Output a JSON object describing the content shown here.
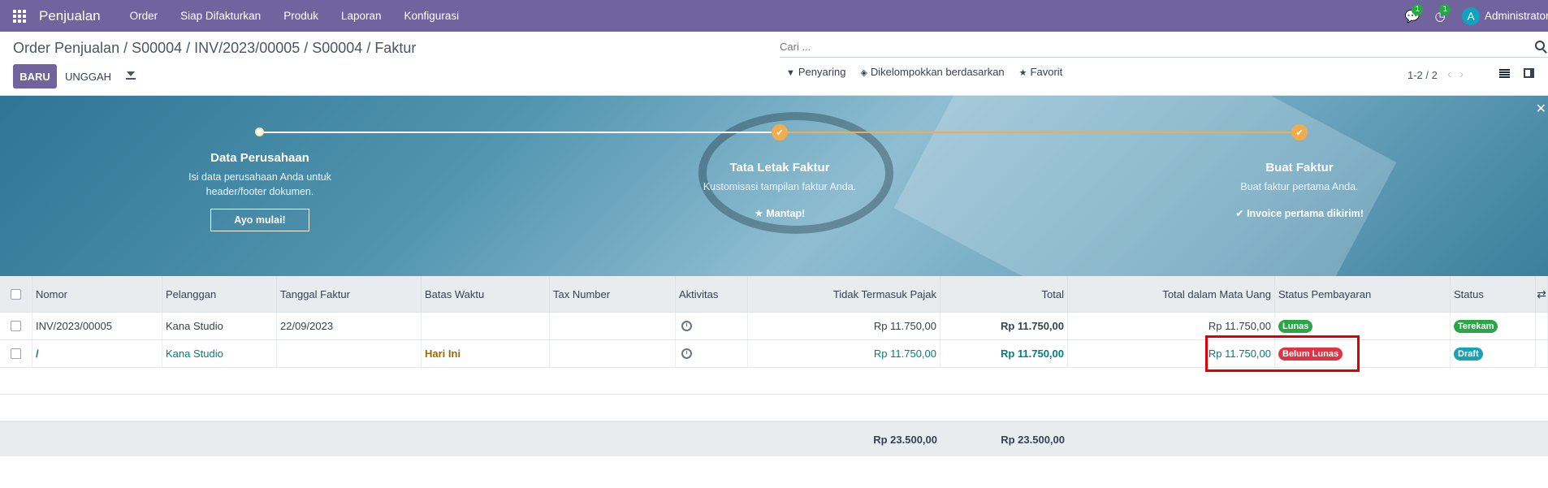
{
  "navbar": {
    "app_name": "Penjualan",
    "menu": [
      "Order",
      "Siap Difakturkan",
      "Produk",
      "Laporan",
      "Konfigurasi"
    ],
    "messages_count": "1",
    "activities_count": "1",
    "user_initial": "A",
    "user_name": "Administrator"
  },
  "control": {
    "breadcrumb": "Order Penjualan / S00004 / INV/2023/00005 / S00004 / Faktur",
    "new_label": "BARU",
    "upload_label": "UNGGAH",
    "search_placeholder": "Cari ...",
    "filters_label": "Penyaring",
    "groupby_label": "Dikelompokkan berdasarkan",
    "favorites_label": "Favorit",
    "pager": "1-2 / 2"
  },
  "onboarding": {
    "steps": [
      {
        "title": "Data Perusahaan",
        "desc": "Isi data perusahaan Anda untuk header/footer dokumen.",
        "button": "Ayo mulai!"
      },
      {
        "title": "Tata Letak Faktur",
        "desc": "Kustomisasi tampilan faktur Anda.",
        "done": "Mantap!"
      },
      {
        "title": "Buat Faktur",
        "desc": "Buat faktur pertama Anda.",
        "done": "Invoice pertama dikirim!"
      }
    ],
    "close_label": "✕"
  },
  "table": {
    "headers": {
      "number": "Nomor",
      "customer": "Pelanggan",
      "invoice_date": "Tanggal Faktur",
      "due_date": "Batas Waktu",
      "tax_number": "Tax Number",
      "activities": "Aktivitas",
      "untaxed": "Tidak Termasuk Pajak",
      "total": "Total",
      "total_currency": "Total dalam Mata Uang",
      "payment_status": "Status Pembayaran",
      "status": "Status"
    },
    "rows": [
      {
        "number": "INV/2023/00005",
        "customer": "Kana Studio",
        "invoice_date": "22/09/2023",
        "due_date": "",
        "untaxed": "Rp 11.750,00",
        "total": "Rp 11.750,00",
        "total_currency": "Rp 11.750,00",
        "payment_status": "Lunas",
        "payment_color": "#28a745",
        "status": "Terekam",
        "status_color": "#28a745"
      },
      {
        "number": "/",
        "customer": "Kana Studio",
        "invoice_date": "",
        "due_date": "Hari Ini",
        "untaxed": "Rp 11.750,00",
        "total": "Rp 11.750,00",
        "total_currency": "Rp 11.750,00",
        "payment_status": "Belum Lunas",
        "payment_color": "#dc3545",
        "status": "Draft",
        "status_color": "#17a2b8"
      }
    ],
    "sum_untaxed": "Rp 23.500,00",
    "sum_total": "Rp 23.500,00"
  },
  "colors": {
    "brand": "#71639e",
    "accent": "#017e84",
    "progress": "#f0ad4e"
  }
}
